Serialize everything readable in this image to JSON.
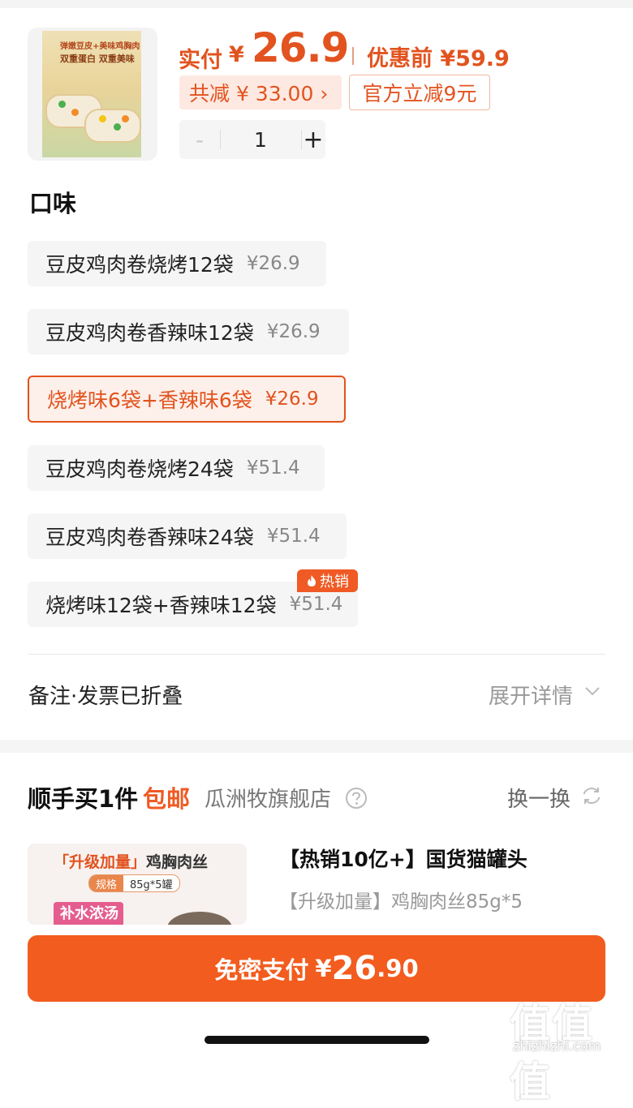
{
  "product": {
    "image_text_line1": "弹嫩豆皮+美味鸡胸肉",
    "image_text_line2": "双重蛋白 双重美味",
    "paid_label": "实付",
    "currency": "¥",
    "paid_price": "26.9",
    "before_label": "优惠前 ¥59.9",
    "total_saving": "共减 ¥ 33.00 ›",
    "promo_tag": "官方立减9元",
    "quantity": "1",
    "minus_symbol": "-",
    "plus_symbol": "+"
  },
  "flavor": {
    "heading": "口味",
    "options": [
      {
        "label": "豆皮鸡肉卷烧烤12袋",
        "price": "¥26.9",
        "selected": false
      },
      {
        "label": "豆皮鸡肉卷香辣味12袋",
        "price": "¥26.9",
        "selected": false
      },
      {
        "label": "烧烤味6袋+香辣味6袋",
        "price": "¥26.9",
        "selected": true
      },
      {
        "label": "豆皮鸡肉卷烧烤24袋",
        "price": "¥51.4",
        "selected": false
      },
      {
        "label": "豆皮鸡肉卷香辣味24袋",
        "price": "¥51.4",
        "selected": false
      },
      {
        "label": "烧烤味12袋+香辣味12袋",
        "price": "¥51.4",
        "selected": false
      }
    ],
    "hot_badge": "热销"
  },
  "notes": {
    "label": "备注·发票已折叠",
    "expand_label": "展开详情"
  },
  "addon": {
    "title": "顺手买1件",
    "free_shipping": "包邮",
    "shop_name": "瓜洲牧旗舰店",
    "switch_label": "换一换",
    "image_headline_accent": "「升级加量」",
    "image_headline": "鸡胸肉丝",
    "image_spec_key": "规格",
    "image_spec_value": "85g*5罐",
    "image_can_text": "补水浓汤",
    "name": "【热销10亿+】国货猫罐头",
    "sku": "【升级加量】鸡胸肉丝85g*5"
  },
  "pay": {
    "label": "免密支付",
    "currency": "¥",
    "amount_int": "26",
    "amount_dec": ".90"
  },
  "watermark": {
    "text": "值值值",
    "url": "zhizhizhi.com"
  },
  "colors": {
    "accent": "#e2531f",
    "pay_button": "#f25c1e",
    "hot_badge": "#f05a24"
  }
}
